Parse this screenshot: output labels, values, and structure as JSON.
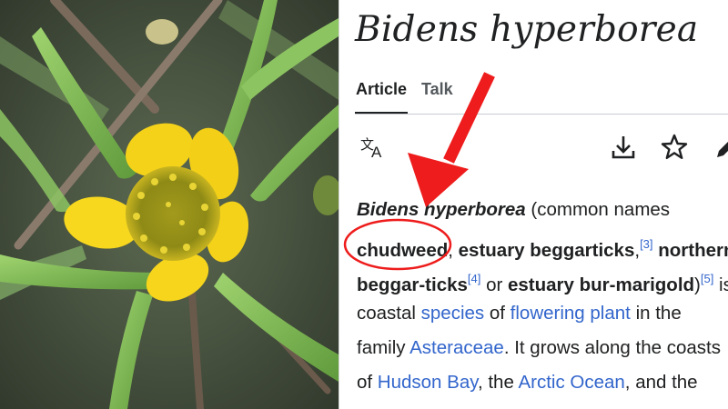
{
  "article": {
    "title": "Bidens hyperborea",
    "tabs": [
      {
        "label": "Article",
        "active": true
      },
      {
        "label": "Talk",
        "active": false
      }
    ],
    "toolbar_icons": [
      "translate-icon",
      "download-icon",
      "star-icon",
      "edit-icon"
    ],
    "paragraph": {
      "l1_bold_italic": "Bidens hyperborea",
      "l1_text": " (common names",
      "l2_bold1": "chudweed",
      "l2_text1": ", ",
      "l2_bold2": "estuary beggarticks",
      "l2_text2": ",",
      "ref3": "[3]",
      "l2_bold3": " northern",
      "l3_bold1": "beggar-ticks",
      "ref4": "[4]",
      "l3_text1": " or ",
      "l3_bold2": "estuary bur-marigold",
      "l3_text2": ")",
      "ref5": "[5]",
      "l3_text3": " is",
      "l4_text1": "coastal ",
      "l4_link1": "species",
      "l4_text2": " of ",
      "l4_link2": "flowering plant",
      "l4_text3": " in the",
      "l5_text1": "family ",
      "l5_link1": "Asteraceae",
      "l5_text2": ". It grows along the coasts",
      "l6_text1": "of ",
      "l6_link1": "Hudson Bay",
      "l6_text2": ", the ",
      "l6_link2": "Arctic Ocean",
      "l6_text3": ", and the"
    }
  },
  "colors": {
    "link": "#3366cc",
    "text": "#202122",
    "annotation": "#ee1c1c",
    "flower_petal": "#f5d21a",
    "leaf": "#7dbf55"
  }
}
